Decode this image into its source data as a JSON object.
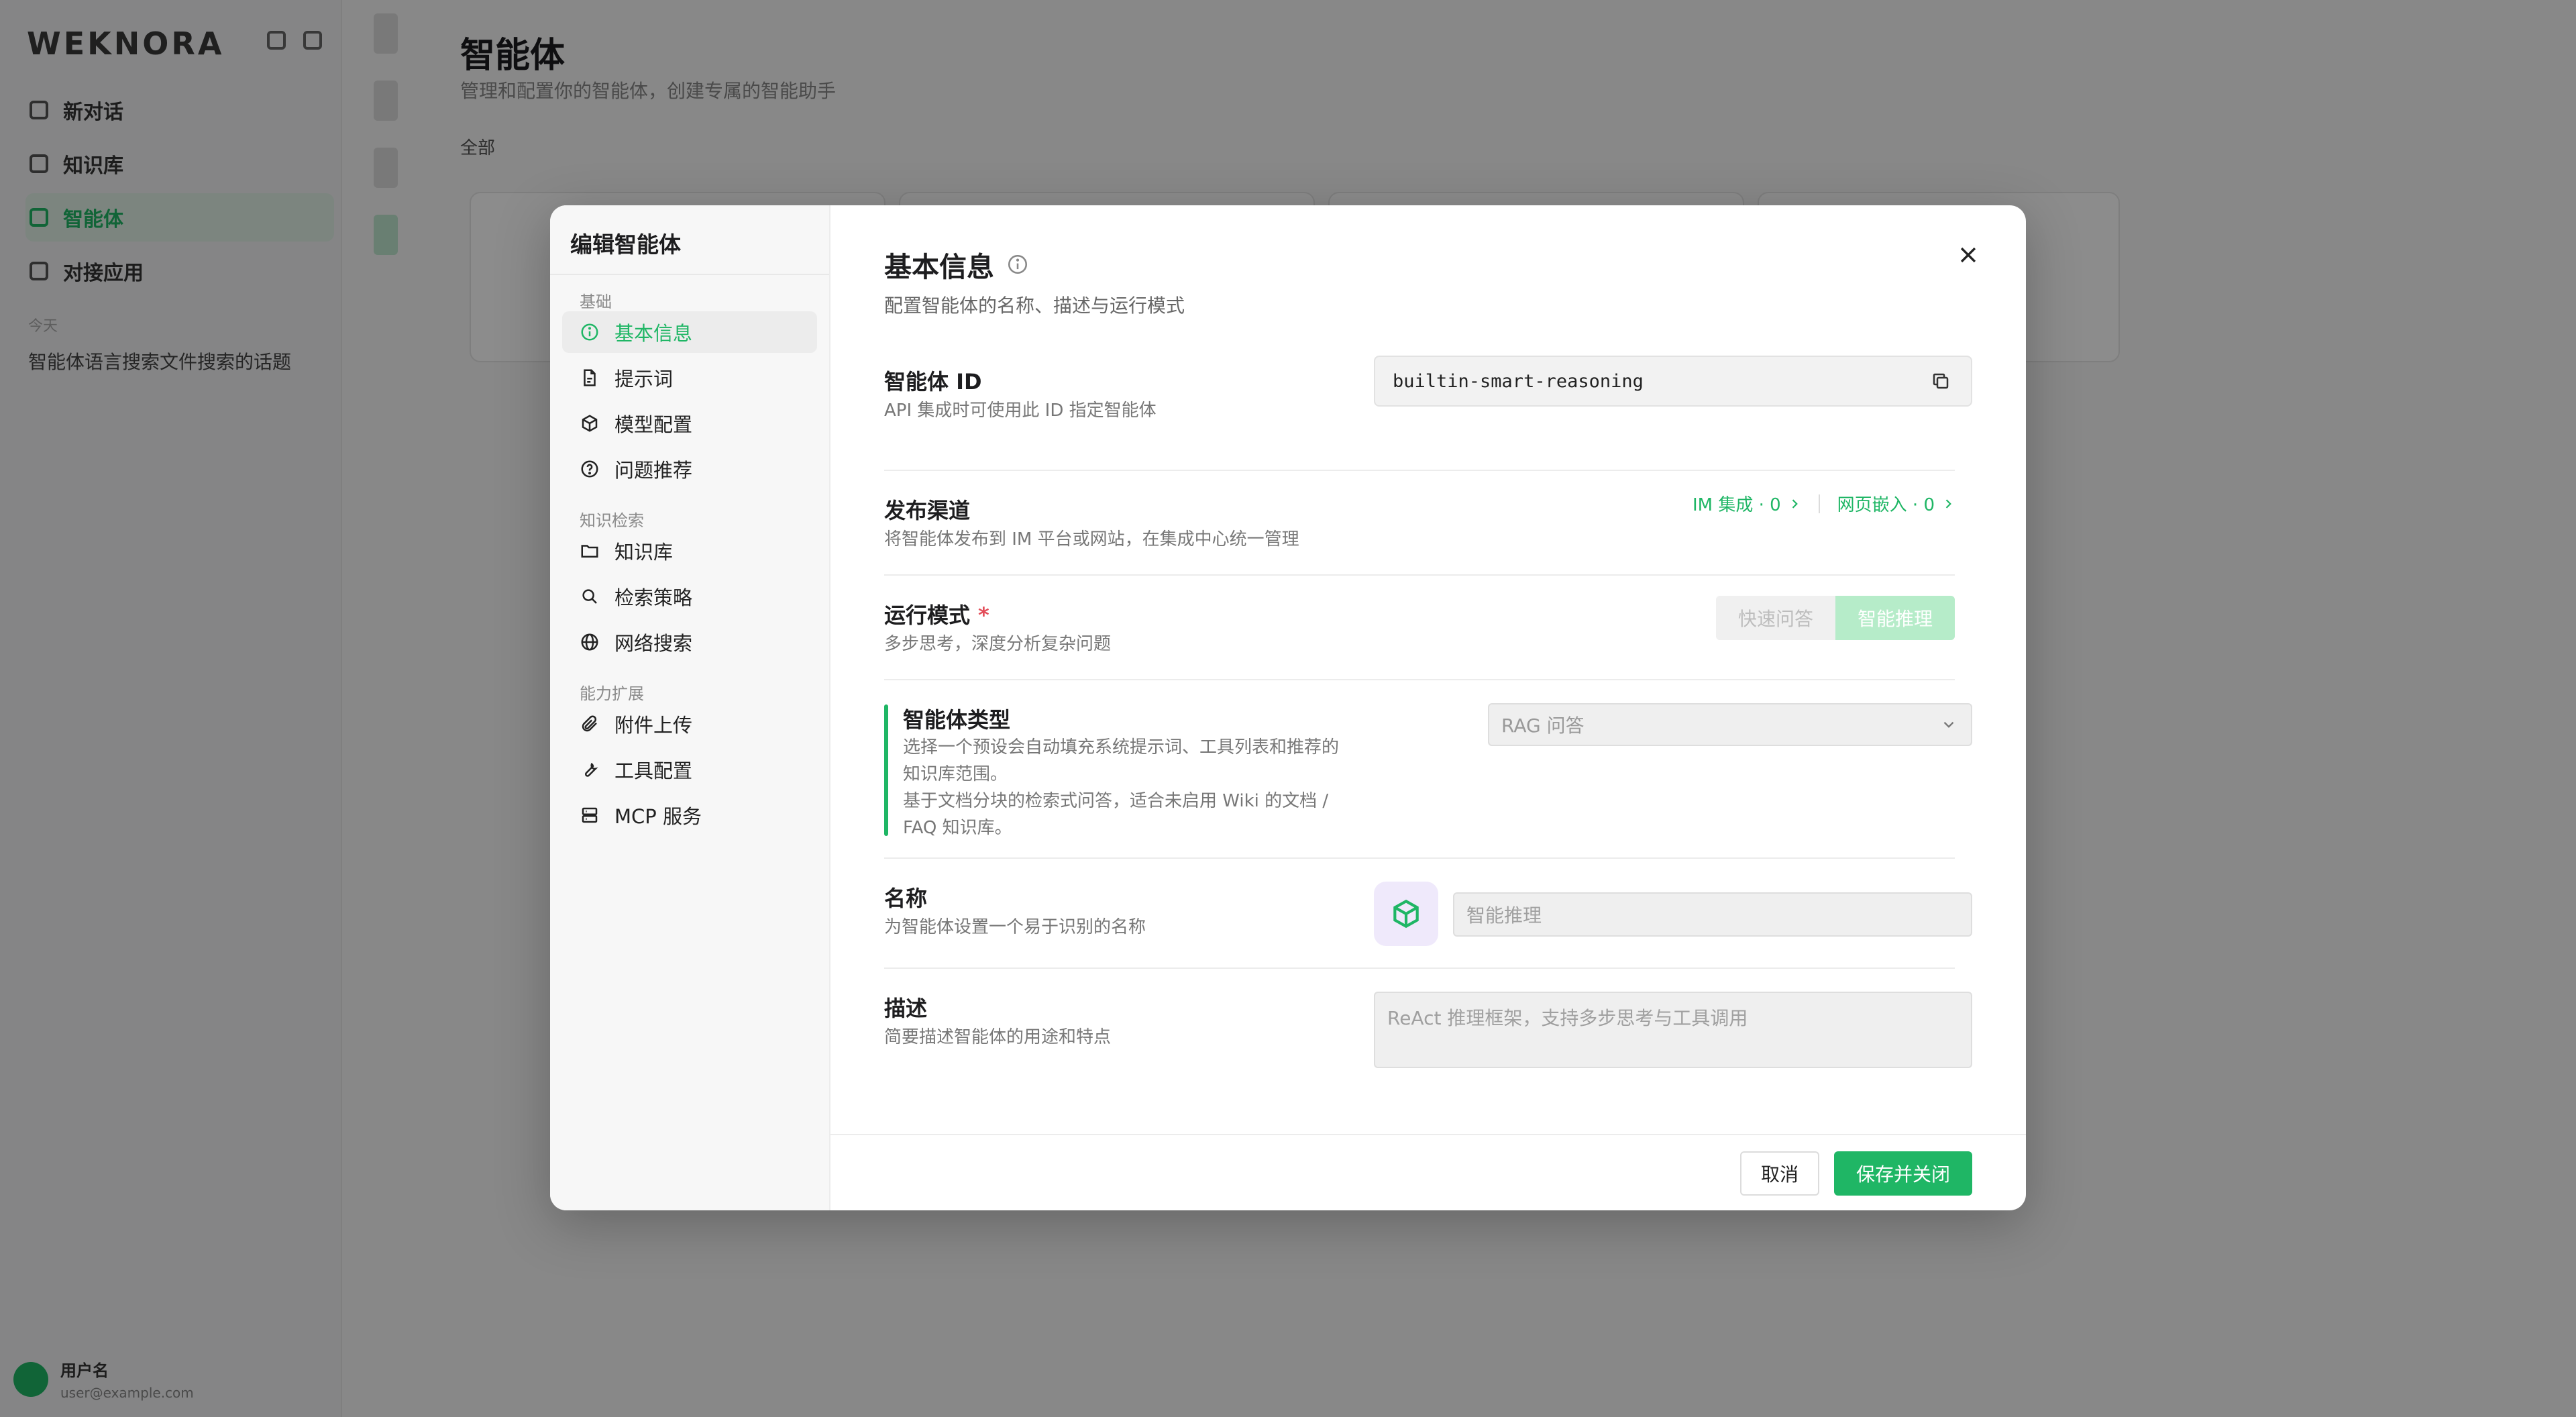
{
  "background": {
    "logo": "WEKNORA",
    "nav": [
      {
        "label": "新对话"
      },
      {
        "label": "知识库"
      },
      {
        "label": "智能体"
      },
      {
        "label": "对接应用"
      }
    ],
    "section_label": "今天",
    "history_item": "智能体语言搜索文件搜索的话题",
    "user_name": "用户名",
    "user_email": "user@example.com",
    "page_title": "智能体",
    "page_subtitle": "管理和配置你的智能体，创建专属的智能助手",
    "tabs": "全部"
  },
  "modal": {
    "title": "编辑智能体",
    "groups": [
      {
        "label": "基础",
        "items": [
          {
            "label": "基本信息",
            "icon": "info-icon",
            "active": true
          },
          {
            "label": "提示词",
            "icon": "document-icon"
          },
          {
            "label": "模型配置",
            "icon": "cube-icon"
          },
          {
            "label": "问题推荐",
            "icon": "question-icon"
          }
        ]
      },
      {
        "label": "知识检索",
        "items": [
          {
            "label": "知识库",
            "icon": "folder-icon"
          },
          {
            "label": "检索策略",
            "icon": "search-icon"
          },
          {
            "label": "网络搜索",
            "icon": "globe-icon"
          }
        ]
      },
      {
        "label": "能力扩展",
        "items": [
          {
            "label": "附件上传",
            "icon": "paperclip-icon"
          },
          {
            "label": "工具配置",
            "icon": "wrench-icon"
          },
          {
            "label": "MCP 服务",
            "icon": "server-icon"
          }
        ]
      }
    ],
    "section": {
      "title": "基本信息",
      "subtitle": "配置智能体的名称、描述与运行模式"
    },
    "fields": {
      "agent_id": {
        "label": "智能体 ID",
        "desc": "API 集成时可使用此 ID 指定智能体",
        "value": "builtin-smart-reasoning"
      },
      "channels": {
        "label": "发布渠道",
        "desc": "将智能体发布到 IM 平台或网站，在集成中心统一管理",
        "im_link": "IM 集成 · 0",
        "web_link": "网页嵌入 · 0"
      },
      "mode": {
        "label": "运行模式",
        "required_mark": "*",
        "desc": "多步思考，深度分析复杂问题",
        "options": [
          "快速问答",
          "智能推理"
        ],
        "selected": "智能推理"
      },
      "agent_type": {
        "label": "智能体类型",
        "desc_lines": [
          "选择一个预设会自动填充系统提示词、工具列表和推荐的",
          "知识库范围。",
          "基于文档分块的检索式问答，适合未启用 Wiki 的文档 /",
          "FAQ 知识库。"
        ],
        "selected": "RAG 问答"
      },
      "name": {
        "label": "名称",
        "desc": "为智能体设置一个易于识别的名称",
        "placeholder": "智能推理"
      },
      "description": {
        "label": "描述",
        "desc": "简要描述智能体的用途和特点",
        "placeholder": "ReAct 推理框架，支持多步思考与工具调用"
      }
    },
    "footer": {
      "cancel": "取消",
      "save": "保存并关闭"
    }
  },
  "colors": {
    "accent": "#1fb665",
    "accent_light": "#b6ecc9",
    "required": "#e34d59"
  }
}
